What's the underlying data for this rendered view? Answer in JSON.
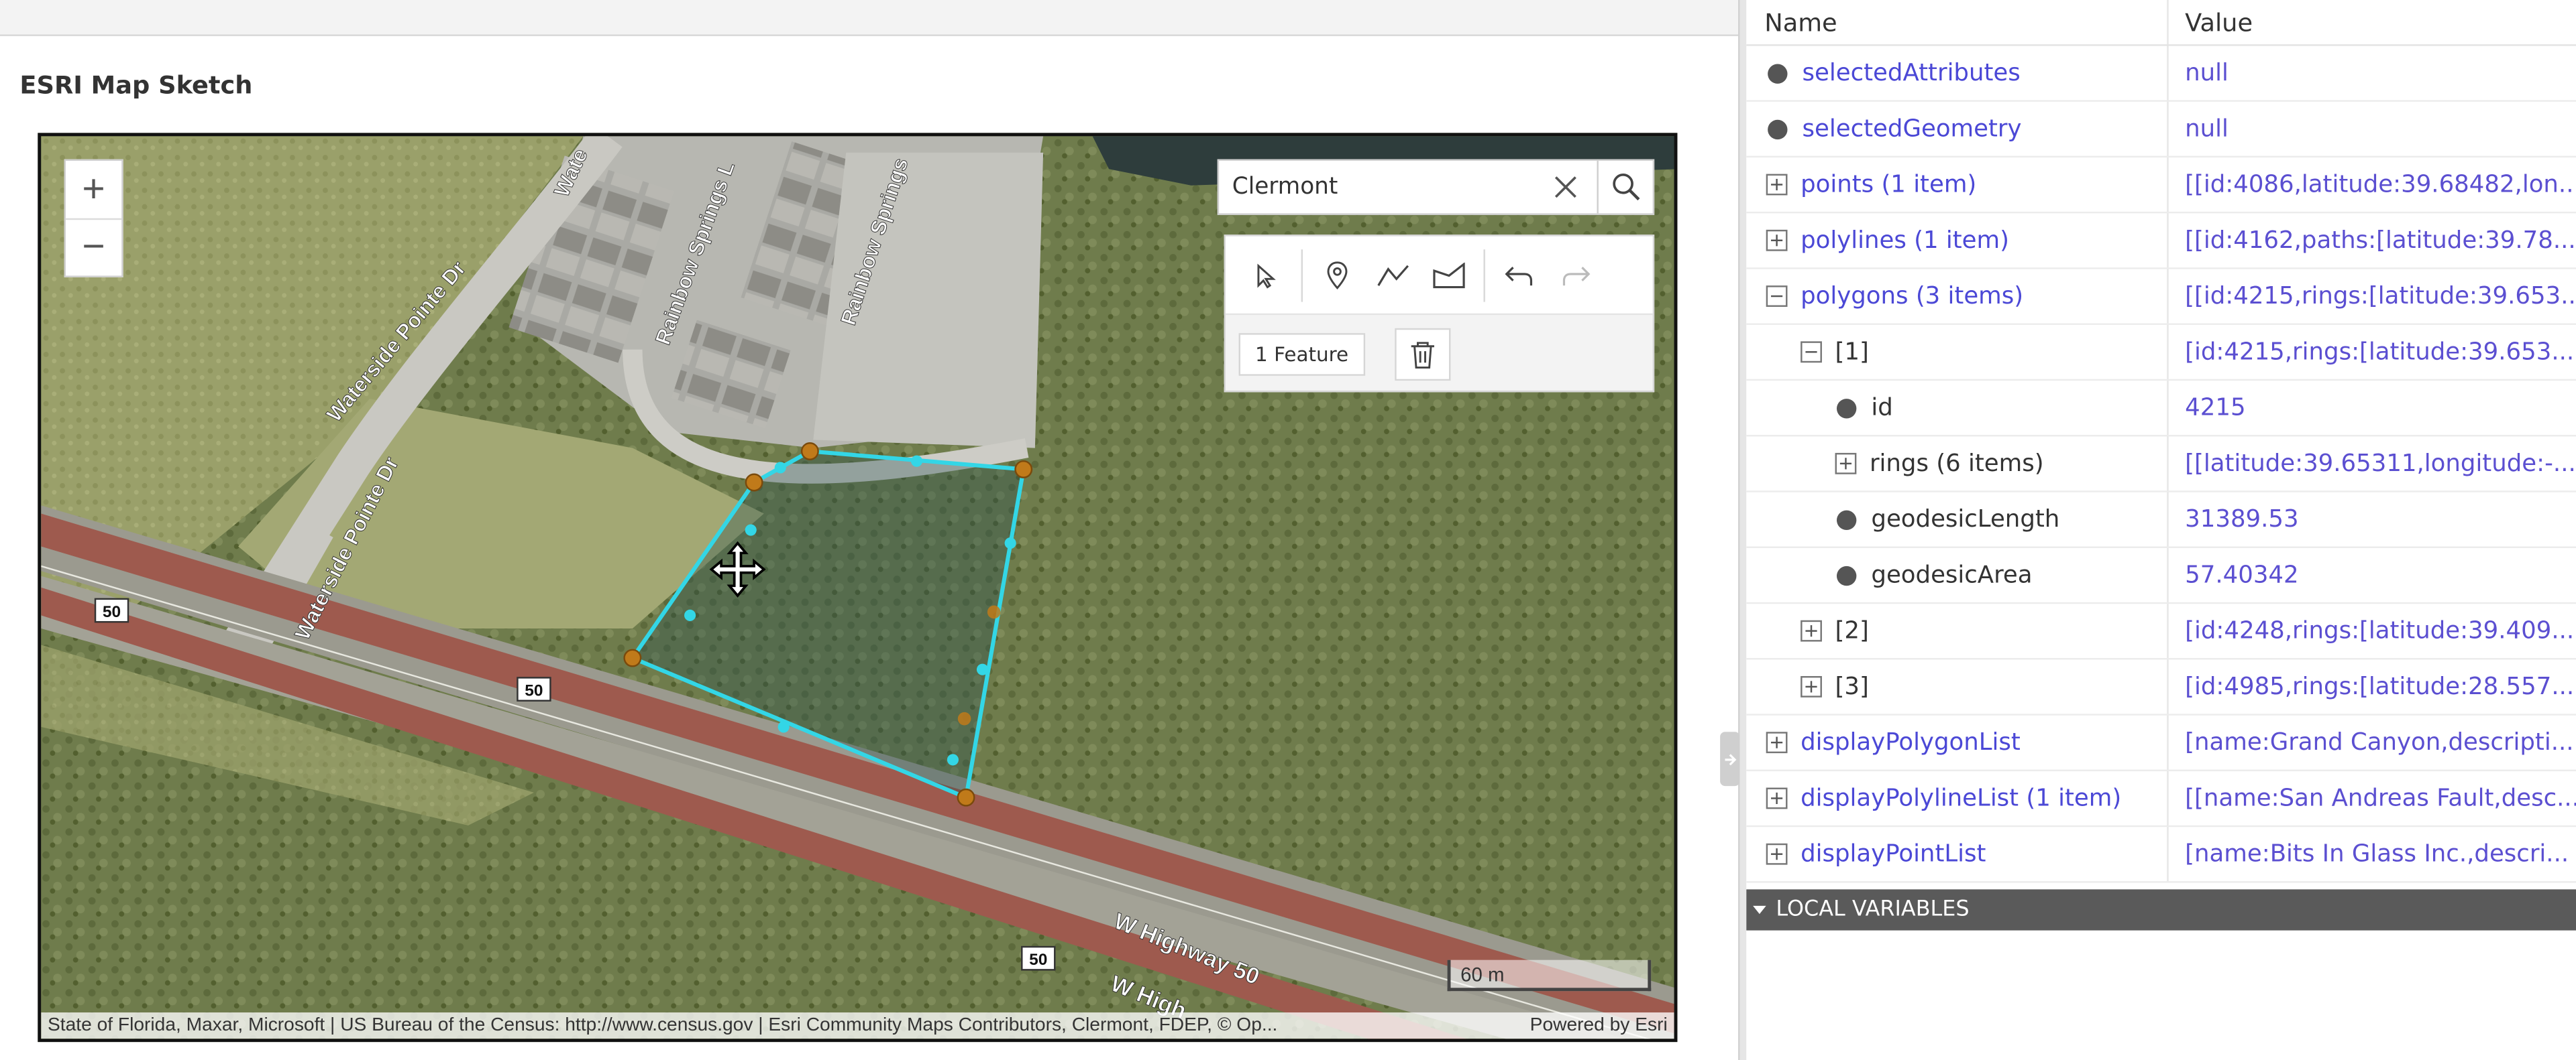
{
  "panel": {
    "title": "ESRI Map Sketch"
  },
  "map": {
    "search_value": "Clermont",
    "zoom_in": "+",
    "zoom_out": "−",
    "sketch_feature_count": "1 Feature",
    "scale_label": "60 m",
    "attribution": "State of Florida, Maxar, Microsoft | US Bureau of the Census: http://www.census.gov | Esri Community Maps Contributors, Clermont, FDEP, © Op...",
    "powered_by": "Powered by Esri",
    "labels": {
      "waterside_1": "Waterside Pointe Dr",
      "waterside_2": "Waterside Pointe Dr",
      "waterside_3": "Wate",
      "rainbow_1": "Rainbow Springs L",
      "rainbow_2": "Rainbow Springs",
      "highway_1": "W Highway 50",
      "highway_2": "W High",
      "shield_1": "50",
      "shield_2": "50",
      "shield_3": "50"
    },
    "colors": {
      "polygon_stroke": "#33d6e6",
      "vertex_fill": "#c07a1a"
    }
  },
  "variables": {
    "header": {
      "name": "Name",
      "value": "Value"
    },
    "rows": [
      {
        "name": "selectedAttributes",
        "value": "null"
      },
      {
        "name": "selectedGeometry",
        "value": "null"
      },
      {
        "name": "points (1 item)",
        "value": "[[id:4086,latitude:39.68482,lon..."
      },
      {
        "name": "polylines (1 item)",
        "value": "[[id:4162,paths:[latitude:39.78..."
      },
      {
        "name": "polygons (3 items)",
        "value": "[[id:4215,rings:[latitude:39.653..."
      },
      {
        "name": "[1]",
        "value": "[id:4215,rings:[latitude:39.653..."
      },
      {
        "name": "id",
        "value": "4215"
      },
      {
        "name": "rings (6 items)",
        "value": "[[latitude:39.65311,longitude:-..."
      },
      {
        "name": "geodesicLength",
        "value": "31389.53"
      },
      {
        "name": "geodesicArea",
        "value": "57.40342"
      },
      {
        "name": "[2]",
        "value": "[id:4248,rings:[latitude:39.409..."
      },
      {
        "name": "[3]",
        "value": "[id:4985,rings:[latitude:28.557..."
      },
      {
        "name": "displayPolygonList",
        "value": "[name:Grand Canyon,descripti..."
      },
      {
        "name": "displayPolylineList (1 item)",
        "value": "[[name:San Andreas Fault,desc..."
      },
      {
        "name": "displayPointList",
        "value": "[name:Bits In Glass Inc.,descri..."
      }
    ],
    "local_variables_label": "LOCAL VARIABLES"
  }
}
